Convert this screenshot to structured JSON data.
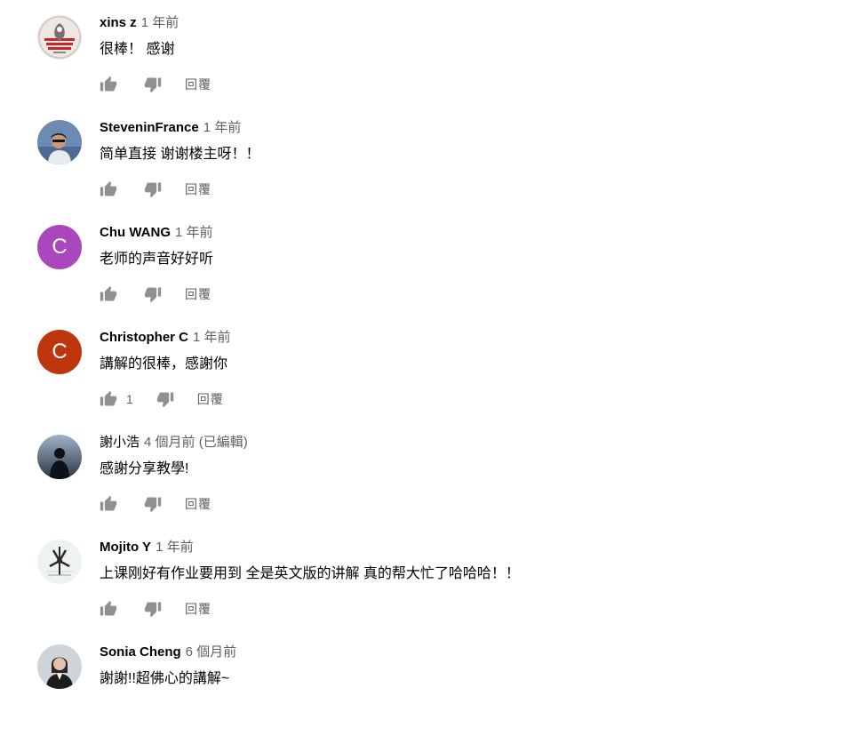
{
  "comments": [
    {
      "author": "xins z",
      "time": "1 年前",
      "text": "很棒！ 感谢",
      "likes": "",
      "reply": "回覆",
      "avatar": {
        "kind": "logo",
        "bg": "#e9e2df"
      }
    },
    {
      "author": "SteveninFrance",
      "time": "1 年前",
      "text": "简单直接 谢谢楼主呀！！",
      "likes": "",
      "reply": "回覆",
      "avatar": {
        "kind": "photo-person",
        "bg": "#6d8ab3"
      }
    },
    {
      "author": "Chu WANG",
      "time": "1 年前",
      "text": "老师的声音好好听",
      "likes": "",
      "reply": "回覆",
      "avatar": {
        "kind": "letter",
        "letter": "C",
        "bg": "#ab47bc"
      }
    },
    {
      "author": "Christopher C",
      "time": "1 年前",
      "text": "講解的很棒，感謝你",
      "likes": "1",
      "reply": "回覆",
      "avatar": {
        "kind": "letter",
        "letter": "C",
        "bg": "#bf360c"
      }
    },
    {
      "author": "謝小浩",
      "time": "4 個月前 (已編輯)",
      "text": "感謝分享教學!",
      "likes": "",
      "reply": "回覆",
      "avatar": {
        "kind": "photo-silhouette",
        "bg": "#2a3442"
      }
    },
    {
      "author": "Mojito Y",
      "time": "1 年前",
      "text": "上课刚好有作业要用到 全是英文版的讲解 真的帮大忙了哈哈哈！！",
      "likes": "",
      "reply": "回覆",
      "avatar": {
        "kind": "logo-mark",
        "bg": "#eef3f1"
      }
    },
    {
      "author": "Sonia Cheng",
      "time": "6 個月前",
      "text": "謝謝!!超佛心的講解~",
      "likes": "",
      "reply": "",
      "avatar": {
        "kind": "photo-woman",
        "bg": "#cfd4d8"
      }
    }
  ],
  "icons": {
    "like": "thumb-up-icon",
    "dislike": "thumb-down-icon"
  },
  "colors": {
    "icon": "#909090",
    "meta": "#606060",
    "text": "#030303"
  }
}
